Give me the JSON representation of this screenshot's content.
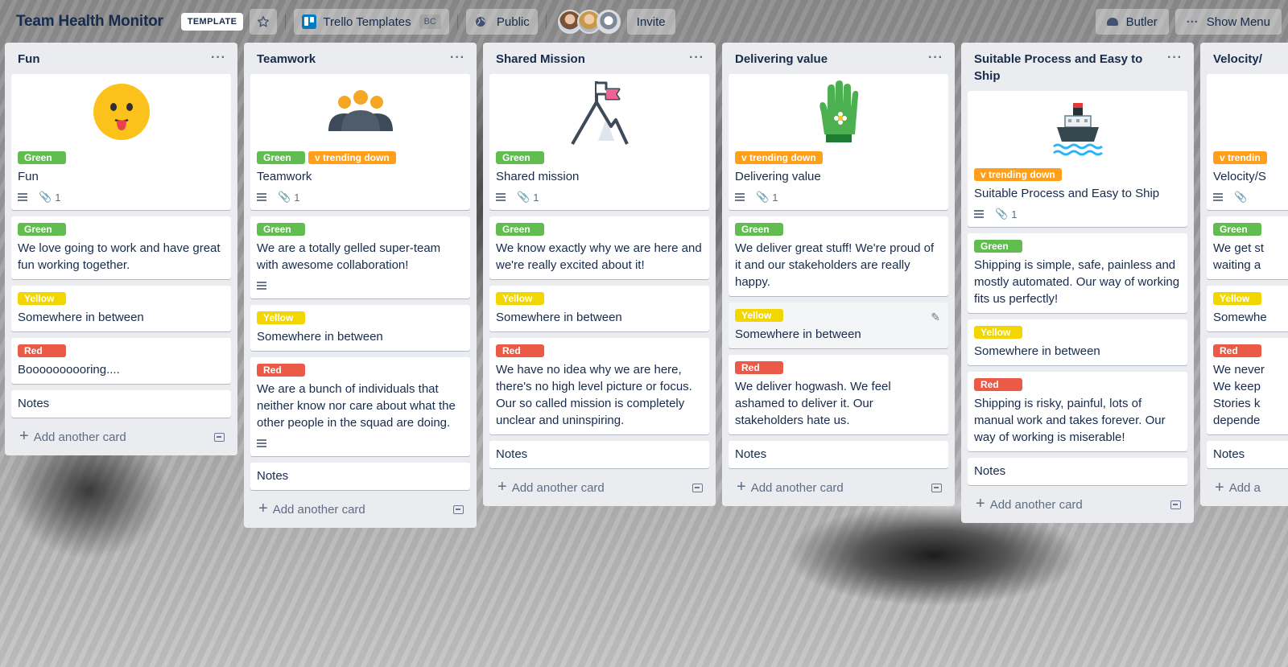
{
  "header": {
    "title": "Team Health Monitor",
    "template_badge": "TEMPLATE",
    "team_name": "Trello Templates",
    "team_badge": "BC",
    "visibility": "Public",
    "invite": "Invite",
    "butler": "Butler",
    "show_menu": "Show Menu"
  },
  "icons": {
    "star": "star-icon",
    "globe": "globe-icon",
    "more": "more-icon"
  },
  "colors": {
    "green": "#61bd4f",
    "yellow": "#f2d600",
    "red": "#eb5a46",
    "orange": "#ff9f1a",
    "list_bg": "#ebecf0"
  },
  "add_card_label": "Add another card",
  "lists": [
    {
      "title": "Fun",
      "cover_card": {
        "labels": [
          "Green"
        ],
        "title": "Fun",
        "attachments": "1",
        "cover": "face-emoji"
      },
      "cards": [
        {
          "label": "Green",
          "title": "We love going to work and have great fun working together."
        },
        {
          "label": "Yellow",
          "title": "Somewhere in between"
        },
        {
          "label": "Red",
          "title": "Boooooooooring...."
        }
      ],
      "notes": "Notes"
    },
    {
      "title": "Teamwork",
      "cover_card": {
        "labels": [
          "Green",
          "v trending down"
        ],
        "title": "Teamwork",
        "attachments": "1",
        "cover": "people"
      },
      "cards": [
        {
          "label": "Green",
          "title": "We are a totally gelled super-team with awesome collaboration!"
        },
        {
          "label": "Yellow",
          "title": "Somewhere in between"
        },
        {
          "label": "Red",
          "title": "We are a bunch of individuals that neither know nor care about what the other people in the squad are doing."
        }
      ],
      "notes": "Notes"
    },
    {
      "title": "Shared Mission",
      "cover_card": {
        "labels": [
          "Green"
        ],
        "title": "Shared mission",
        "attachments": "1",
        "cover": "mountain-flag"
      },
      "cards": [
        {
          "label": "Green",
          "title": "We know exactly why we are here and we're really excited about it!"
        },
        {
          "label": "Yellow",
          "title": "Somewhere in between"
        },
        {
          "label": "Red",
          "title": "We have no idea why we are here, there's no high level picture or focus. Our so called mission is completely unclear and uninspiring."
        }
      ],
      "notes": "Notes"
    },
    {
      "title": "Delivering value",
      "cover_card": {
        "labels": [
          "v trending down"
        ],
        "title": "Delivering value",
        "attachments": "1",
        "cover": "glove"
      },
      "cards": [
        {
          "label": "Green",
          "title": "We deliver great stuff! We're proud of it and our stakeholders are really happy."
        },
        {
          "label": "Yellow",
          "title": "Somewhere in between"
        },
        {
          "label": "Red",
          "title": "We deliver hogwash. We feel ashamed to deliver it. Our stakeholders hate us."
        }
      ],
      "notes": "Notes"
    },
    {
      "title": "Suitable Process and Easy to Ship",
      "cover_card": {
        "labels": [
          "v trending down"
        ],
        "title": "Suitable Process and Easy to Ship",
        "attachments": "1",
        "cover": "ship"
      },
      "cards": [
        {
          "label": "Green",
          "title": "Shipping is simple, safe, painless and mostly automated. Our way of working fits us perfectly!"
        },
        {
          "label": "Yellow",
          "title": "Somewhere in between"
        },
        {
          "label": "Red",
          "title": "Shipping is risky, painful, lots of manual work and takes forever. Our way of working is miserable!"
        }
      ],
      "notes": "Notes"
    },
    {
      "title": "Velocity/",
      "cover_card": {
        "labels": [
          "v trendin"
        ],
        "title": "Velocity/S"
      },
      "cards": [
        {
          "label": "Green",
          "title": "We get st waiting a"
        },
        {
          "label": "Yellow",
          "title": "Somewhe"
        },
        {
          "label": "Red",
          "title": "We never We keep Stories k depende"
        }
      ],
      "notes": "Notes",
      "add_partial": "Add a"
    }
  ]
}
